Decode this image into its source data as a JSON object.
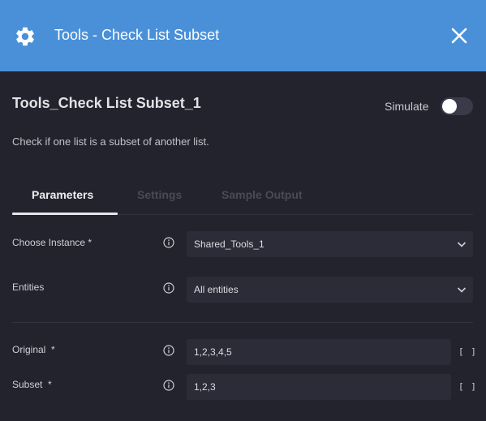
{
  "header": {
    "title": "Tools - Check List Subset",
    "icon": "gear-icon",
    "close_icon": "close-icon",
    "background": "#4a90d9"
  },
  "node": {
    "name": "Tools_Check List Subset_1",
    "description": "Check if one list is a subset of another list.",
    "simulate_label": "Simulate",
    "simulate_on": false
  },
  "tabs": [
    {
      "label": "Parameters",
      "active": true
    },
    {
      "label": "Settings",
      "active": false
    },
    {
      "label": "Sample Output",
      "active": false
    }
  ],
  "params": {
    "instance": {
      "label": "Choose Instance *",
      "value": "Shared_Tools_1"
    },
    "entities": {
      "label": "Entities",
      "value": "All entities"
    },
    "original": {
      "label": "Original  *",
      "value": "1,2,3,4,5",
      "list_icon": "[ ]"
    },
    "subset": {
      "label": "Subset  *",
      "value": "1,2,3",
      "list_icon": "[ ]"
    }
  }
}
